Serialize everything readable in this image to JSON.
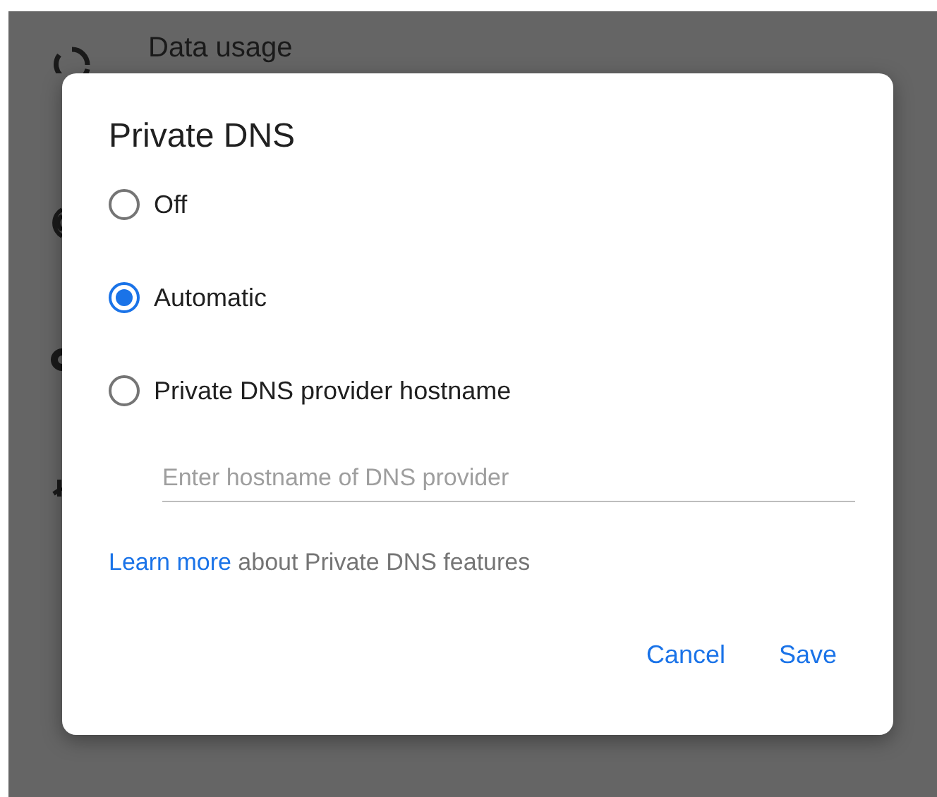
{
  "background": {
    "items": [
      {
        "label": "Data usage"
      }
    ]
  },
  "dialog": {
    "title": "Private DNS",
    "options": [
      {
        "label": "Off",
        "selected": false
      },
      {
        "label": "Automatic",
        "selected": true
      },
      {
        "label": "Private DNS provider hostname",
        "selected": false
      }
    ],
    "hostname_field": {
      "placeholder": "Enter hostname of DNS provider"
    },
    "footer": {
      "link": "Learn more",
      "text": "about Private DNS features"
    },
    "buttons": [
      "Cancel",
      "Save"
    ]
  }
}
